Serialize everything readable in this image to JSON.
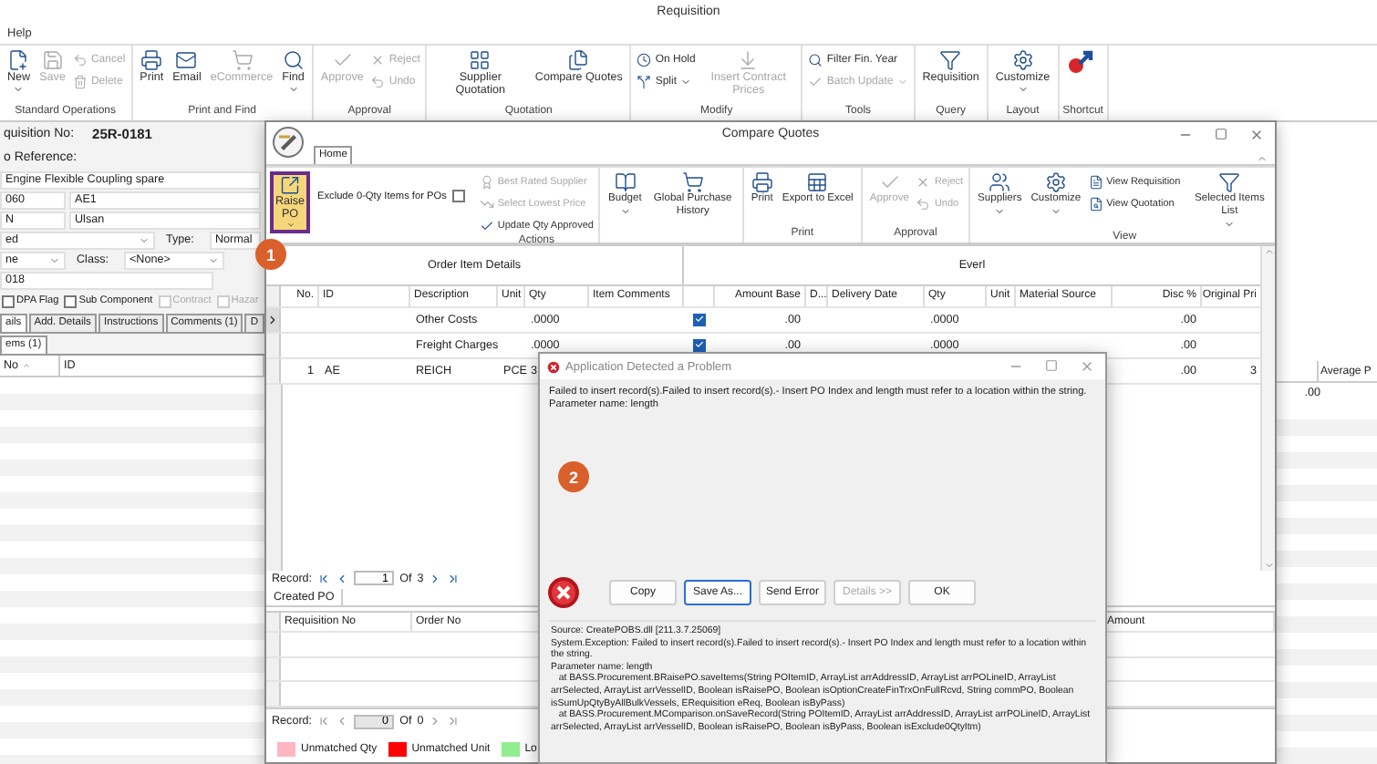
{
  "app": {
    "title": "Requisition",
    "menu": [
      "Help"
    ],
    "ribbon": [
      {
        "label": "Standard Operations",
        "items": [
          {
            "kind": "large",
            "label": "New",
            "disabled": false,
            "dropdown": true
          },
          {
            "kind": "large",
            "label": "Save",
            "disabled": true,
            "dropdown": false
          },
          {
            "kind": "small",
            "label": "Cancel",
            "disabled": true,
            "dropdown": false
          },
          {
            "kind": "small",
            "label": "Delete",
            "disabled": true,
            "dropdown": false
          }
        ]
      },
      {
        "label": "Print and Find",
        "items": [
          {
            "kind": "large",
            "label": "Print",
            "disabled": false,
            "dropdown": false
          },
          {
            "kind": "large",
            "label": "Email",
            "disabled": false,
            "dropdown": false
          },
          {
            "kind": "large",
            "label": "eCommerce",
            "disabled": true,
            "dropdown": false
          },
          {
            "kind": "large",
            "label": "Find",
            "disabled": false,
            "dropdown": true
          }
        ]
      },
      {
        "label": "Approval",
        "items": [
          {
            "kind": "large",
            "label": "Approve",
            "disabled": true,
            "dropdown": false
          },
          {
            "kind": "small",
            "label": "Reject",
            "disabled": true,
            "dropdown": false
          },
          {
            "kind": "small",
            "label": "Undo",
            "disabled": true,
            "dropdown": false
          }
        ]
      },
      {
        "label": "Quotation",
        "items": [
          {
            "kind": "large",
            "label": "Supplier Quotation",
            "disabled": false,
            "dropdown": false
          },
          {
            "kind": "large",
            "label": "Compare Quotes",
            "disabled": false,
            "dropdown": false
          }
        ]
      },
      {
        "label": "Modify",
        "items": [
          {
            "kind": "small",
            "label": "On Hold",
            "disabled": false,
            "dropdown": false
          },
          {
            "kind": "small",
            "label": "Split",
            "disabled": false,
            "dropdown": true
          },
          {
            "kind": "large",
            "label": "Insert Contract Prices",
            "disabled": true,
            "dropdown": false
          }
        ]
      },
      {
        "label": "Tools",
        "items": [
          {
            "kind": "small",
            "label": "Filter Fin. Year",
            "disabled": false,
            "dropdown": false
          },
          {
            "kind": "small",
            "label": "Batch Update",
            "disabled": true,
            "dropdown": true
          }
        ]
      },
      {
        "label": "Query",
        "items": [
          {
            "kind": "large",
            "label": "Requisition",
            "disabled": false,
            "dropdown": false
          }
        ]
      },
      {
        "label": "Layout",
        "items": [
          {
            "kind": "large",
            "label": "Customize",
            "disabled": false,
            "dropdown": true
          }
        ]
      },
      {
        "label": "Shortcut",
        "items": [
          {
            "kind": "large",
            "disabled": false,
            "dropdown": false
          }
        ]
      }
    ],
    "form": {
      "number_label": "quisition No:",
      "number": "25R-0181",
      "reference_label": "o Reference:",
      "lines": [
        {
          "cells": [
            {
              "kind": "input",
              "text": "Engine Flexible Coupling spare"
            }
          ]
        },
        {
          "cells": [
            {
              "kind": "input",
              "text": "060"
            },
            {
              "kind": "input",
              "text": "AE1"
            }
          ]
        },
        {
          "cells": [
            {
              "kind": "input",
              "text": "N"
            },
            {
              "kind": "input",
              "text": "Ulsan"
            }
          ]
        },
        {
          "cells": [
            {
              "kind": "select",
              "text": "ed"
            },
            {
              "kind": "label",
              "text": "Type:"
            },
            {
              "kind": "input",
              "text": "Normal"
            }
          ]
        },
        {
          "cells": [
            {
              "kind": "select",
              "text": "ne"
            },
            {
              "kind": "label",
              "text": "Class:"
            },
            {
              "kind": "select",
              "text": "<None>"
            }
          ]
        },
        {
          "cells": [
            {
              "kind": "input",
              "text": "018"
            }
          ]
        }
      ],
      "checkboxes": [
        {
          "label": "DPA Flag",
          "checked": false,
          "disabled": false
        },
        {
          "label": "Sub Component",
          "checked": false,
          "disabled": false
        },
        {
          "label": "Contract",
          "checked": false,
          "disabled": true
        },
        {
          "label": "Hazar",
          "checked": false,
          "disabled": true
        }
      ],
      "tabs": [
        {
          "label": "ails",
          "selected": true
        },
        {
          "label": "Add. Details",
          "selected": false
        },
        {
          "label": "Instructions",
          "selected": false
        },
        {
          "label": "Comments (1)",
          "selected": false
        },
        {
          "label": "D",
          "selected": false
        }
      ],
      "subtabs": [
        {
          "label": "ems (1)",
          "selected": true
        }
      ],
      "grid_columns": [
        "No",
        "ID"
      ]
    },
    "background_grid": {
      "header": "Average P",
      "cell": ".00"
    }
  },
  "compare": {
    "title": "Compare Quotes",
    "tabs": [
      {
        "label": "Home",
        "selected": true
      }
    ],
    "raise_po": {
      "label": "Raise PO",
      "dropdown": true,
      "highlighted": true
    },
    "exclude_zero_qty": {
      "label": "Exclude 0-Qty Items for POs",
      "checked": false
    },
    "ribbon": [
      {
        "label": "Actions",
        "items": [
          {
            "kind": "small",
            "label": "Best Rated Supplier",
            "disabled": true,
            "dropdown": false
          },
          {
            "kind": "small",
            "label": "Select Lowest Price",
            "disabled": true,
            "dropdown": false
          },
          {
            "kind": "small",
            "label": "Update Qty Approved",
            "disabled": false,
            "dropdown": false
          }
        ]
      },
      {
        "items": [
          {
            "kind": "large",
            "label": "Budget",
            "disabled": false,
            "dropdown": true
          },
          {
            "kind": "large",
            "label": "Global Purchase History",
            "disabled": false,
            "dropdown": false
          }
        ]
      },
      {
        "label": "Print",
        "items": [
          {
            "kind": "large",
            "label": "Print",
            "disabled": false,
            "dropdown": false
          },
          {
            "kind": "large",
            "label": "Export to Excel",
            "disabled": false,
            "dropdown": false
          }
        ]
      },
      {
        "label": "Approval",
        "items": [
          {
            "kind": "large",
            "label": "Approve",
            "disabled": true,
            "dropdown": false
          },
          {
            "kind": "small",
            "label": "Reject",
            "disabled": true,
            "dropdown": false
          },
          {
            "kind": "small",
            "label": "Undo",
            "disabled": true,
            "dropdown": false
          }
        ]
      },
      {
        "label": "View",
        "items": [
          {
            "kind": "large",
            "label": "Suppliers",
            "disabled": false,
            "dropdown": true
          },
          {
            "kind": "large",
            "label": "Customize",
            "disabled": false,
            "dropdown": true
          },
          {
            "kind": "small",
            "label": "View Requisition",
            "disabled": false,
            "dropdown": false
          },
          {
            "kind": "small",
            "label": "View Quotation",
            "disabled": false,
            "dropdown": false
          },
          {
            "kind": "large",
            "label": "Selected Items List",
            "disabled": false,
            "dropdown": true
          }
        ]
      }
    ],
    "grid": {
      "bands": [
        {
          "label": "Order Item Details"
        },
        {
          "label": "Everl"
        }
      ],
      "columns": [
        {
          "kind": "text",
          "label": "No."
        },
        {
          "kind": "text",
          "label": "ID"
        },
        {
          "kind": "text",
          "label": "Description"
        },
        {
          "kind": "text",
          "label": "Unit"
        },
        {
          "kind": "text",
          "label": "Qty"
        },
        {
          "kind": "text",
          "label": "Item Comments"
        },
        {
          "kind": "check"
        },
        {
          "kind": "text",
          "label": "Amount Base"
        },
        {
          "kind": "text",
          "label": "D..."
        },
        {
          "kind": "text",
          "label": "Delivery Date"
        },
        {
          "kind": "text",
          "label": "Qty"
        },
        {
          "kind": "text",
          "label": "Unit"
        },
        {
          "kind": "text",
          "label": "Material Source"
        },
        {
          "kind": "text",
          "label": "Disc %"
        },
        {
          "kind": "text",
          "label": "Original Pri"
        }
      ],
      "rows": [
        {
          "current": true,
          "checked": true,
          "cells": [
            null,
            null,
            "Other Costs",
            null,
            ".0000",
            null,
            null,
            ".00",
            null,
            null,
            ".0000",
            null,
            null,
            ".00",
            null
          ]
        },
        {
          "current": false,
          "checked": true,
          "cells": [
            null,
            null,
            "Freight Charges",
            null,
            ".0000",
            null,
            null,
            ".00",
            null,
            null,
            ".0000",
            null,
            null,
            ".00",
            null
          ]
        },
        {
          "current": false,
          "cells": [
            "1",
            "AE",
            "REICH",
            "PCE",
            "3",
            null,
            null,
            null,
            null,
            null,
            null,
            null,
            null,
            ".00",
            "3"
          ]
        }
      ]
    },
    "navigator": {
      "label": "Record:",
      "value": "1",
      "of_label": "Of",
      "total": "3",
      "disabled": false
    },
    "created_po": {
      "tab": {
        "label": "Created PO",
        "selected": true
      },
      "columns": [
        "Requisition No",
        "Order No",
        "Amount"
      ],
      "navigator": {
        "label": "Record:",
        "value": "0",
        "of_label": "Of",
        "total": "0",
        "disabled": true
      }
    },
    "legend": [
      {
        "label": "Unmatched Qty",
        "color": "#ffb6c1"
      },
      {
        "label": "Unmatched Unit",
        "color": "#ff0000"
      },
      {
        "label": "Lo",
        "color": "#90ee90"
      }
    ]
  },
  "dialog": {
    "title": "Application Detected a Problem",
    "message": [
      "Failed to insert record(s).Failed to insert record(s).- Insert PO Index and length must refer to a location within the string.",
      "Parameter name: length"
    ],
    "buttons": [
      {
        "label": "Copy",
        "disabled": false,
        "focused": false
      },
      {
        "label": "Save As...",
        "disabled": false,
        "focused": true
      },
      {
        "label": "Send Error",
        "disabled": false,
        "focused": false
      },
      {
        "label": "Details >>",
        "disabled": true,
        "focused": false
      },
      {
        "label": "OK",
        "disabled": false,
        "focused": false
      }
    ],
    "details": [
      "Source: CreatePOBS.dll [211.3.7.25069]",
      "System.Exception: Failed to insert record(s).Failed to insert record(s).- Insert PO Index and length must refer to a location within the string.",
      "Parameter name: length",
      "   at BASS.Procurement.BRaisePO.saveItems(String POItemID, ArrayList arrAddressID, ArrayList arrPOLineID, ArrayList arrSelected, ArrayList arrVesselID, Boolean isRaisePO, Boolean isOptionCreateFinTrxOnFullRcvd, String commPO, Boolean isSumUpQtyByAllBulkVessels, ERequisition eReq, Boolean isByPass)",
      "   at BASS.Procurement.MComparison.onSaveRecord(String POItemID, ArrayList arrAddressID, ArrayList arrPOLineID, ArrayList arrSelected, ArrayList arrVesselID, Boolean isRaisePO, Boolean isByPass, Boolean isExclude0QtyItm)"
    ]
  },
  "annotations": [
    {
      "label": "1"
    },
    {
      "label": "2"
    }
  ]
}
